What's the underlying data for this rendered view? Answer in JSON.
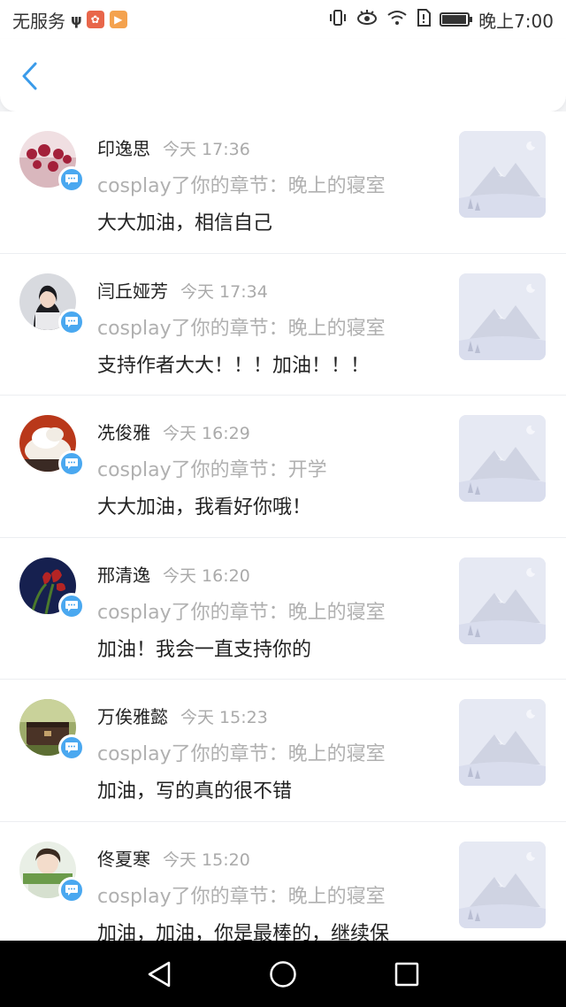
{
  "status_bar": {
    "carrier": "无服务",
    "time": "晚上7:00"
  },
  "header": {
    "back_icon": "chevron-left-icon",
    "accent_color": "#3a9bea"
  },
  "comments": [
    {
      "name": "印逸思",
      "time": "今天 17:36",
      "context": "cosplay了你的章节：晚上的寝室",
      "message": "大大加油，相信自己",
      "avatar_color": "#b8334b"
    },
    {
      "name": "闫丘娅芳",
      "time": "今天 17:34",
      "context": "cosplay了你的章节：晚上的寝室",
      "message": "支持作者大大！！！加油！！！",
      "avatar_color": "#6b6f78"
    },
    {
      "name": "冼俊雅",
      "time": "今天 16:29",
      "context": "cosplay了你的章节：开学",
      "message": "大大加油，我看好你哦！",
      "avatar_color": "#c0441f"
    },
    {
      "name": "邢清逸",
      "time": "今天 16:20",
      "context": "cosplay了你的章节：晚上的寝室",
      "message": "加油！我会一直支持你的",
      "avatar_color": "#1f2a66"
    },
    {
      "name": "万俟雅懿",
      "time": "今天 15:23",
      "context": "cosplay了你的章节：晚上的寝室",
      "message": "加油，写的真的很不错",
      "avatar_color": "#6b7b3a"
    },
    {
      "name": "佟夏寒",
      "time": "今天 15:20",
      "context": "cosplay了你的章节：晚上的寝室",
      "message": "加油，加油，你是最棒的，继续保",
      "avatar_color": "#8cb08a"
    }
  ],
  "nav_bar": {
    "back_icon": "nav-back-triangle-icon",
    "home_icon": "nav-home-circle-icon",
    "recent_icon": "nav-recent-square-icon"
  }
}
